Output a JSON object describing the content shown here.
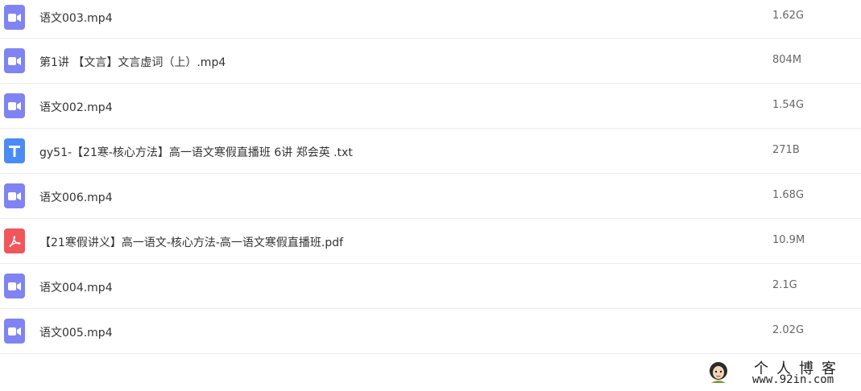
{
  "files": [
    {
      "name": "语文003.mp4",
      "size": "1.62G",
      "type": "video"
    },
    {
      "name": "第1讲 【文言】文言虚词（上）.mp4",
      "size": "804M",
      "type": "video"
    },
    {
      "name": "语文002.mp4",
      "size": "1.54G",
      "type": "video"
    },
    {
      "name": "gy51-【21寒-核心方法】高一语文寒假直播班 6讲 郑会英 .txt",
      "size": "271B",
      "type": "text"
    },
    {
      "name": "语文006.mp4",
      "size": "1.68G",
      "type": "video"
    },
    {
      "name": "【21寒假讲义】高一语文-核心方法-高一语文寒假直播班.pdf",
      "size": "10.9M",
      "type": "pdf"
    },
    {
      "name": "语文004.mp4",
      "size": "2.1G",
      "type": "video"
    },
    {
      "name": "语文005.mp4",
      "size": "2.02G",
      "type": "video"
    }
  ],
  "icons": {
    "video": "video-file-icon",
    "text": "text-file-icon",
    "pdf": "pdf-file-icon"
  },
  "colors": {
    "video_icon": "#7f84f2",
    "text_icon": "#4a8bf5",
    "pdf_icon": "#f0565b",
    "divider": "#ececf0"
  },
  "watermark": {
    "title": "个人博客",
    "url": "www.92in.com"
  }
}
